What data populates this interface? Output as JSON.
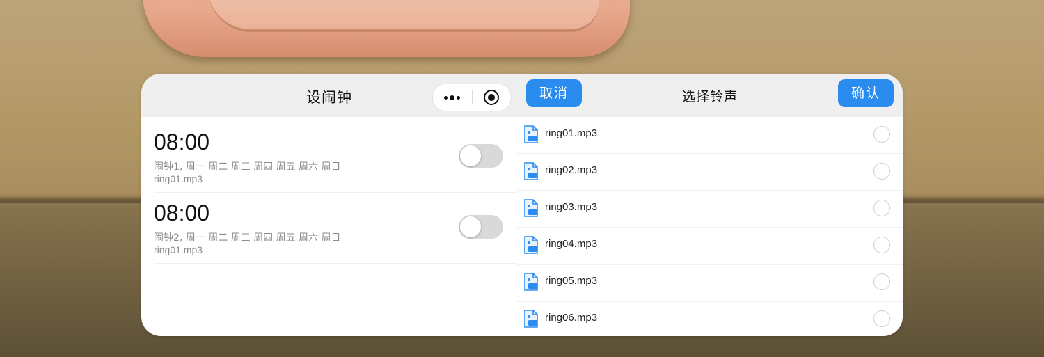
{
  "colors": {
    "accent": "#2b8cf0",
    "panel_bg": "#ffffff",
    "header_bg": "#efefef",
    "toggle_off": "#d9d9d9",
    "muted_text": "#8a8a8a"
  },
  "left": {
    "title": "设闹钟",
    "capsule": {
      "more_icon": "more-dots-icon",
      "close_icon": "target-close-icon"
    },
    "alarms": [
      {
        "time": "08:00",
        "desc": "闹钟1, 周一 周二 周三 周四 周五 周六 周日",
        "ring": "ring01.mp3",
        "enabled": false
      },
      {
        "time": "08:00",
        "desc": "闹钟2, 周一 周二 周三 周四 周五 周六 周日",
        "ring": "ring01.mp3",
        "enabled": false
      }
    ]
  },
  "right": {
    "cancel_label": "取消",
    "title": "选择铃声",
    "confirm_label": "确认",
    "ringtones": [
      {
        "name": "ring01.mp3",
        "selected": false
      },
      {
        "name": "ring02.mp3",
        "selected": false
      },
      {
        "name": "ring03.mp3",
        "selected": false
      },
      {
        "name": "ring04.mp3",
        "selected": false
      },
      {
        "name": "ring05.mp3",
        "selected": false
      },
      {
        "name": "ring06.mp3",
        "selected": false
      }
    ]
  }
}
